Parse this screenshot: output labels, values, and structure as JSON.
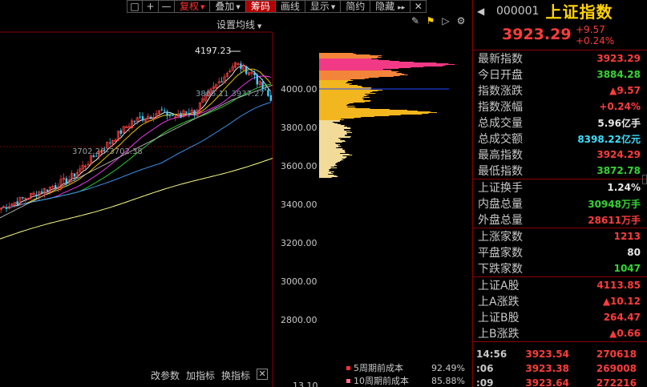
{
  "toolbar": {
    "buttons": [
      "□",
      "+",
      "—",
      "复权",
      "叠加",
      "筹码",
      "画线",
      "显示",
      "简约",
      "隐藏"
    ],
    "chevrons": "▸▸",
    "close": "✕",
    "tools": [
      "🖊",
      "⚑",
      "▷",
      "⚙"
    ]
  },
  "chart": {
    "ma_setting": "设置均线",
    "price_ticks": [
      "4000.00",
      "3800.00",
      "3600.00",
      "3400.00",
      "3200.00",
      "3000.00",
      "2800.00"
    ],
    "partial_tick": "13.10",
    "annotations": {
      "high": "4197.23",
      "ma_values": "3865.11 3937.27",
      "cost_range": "3702.26–3702.38"
    },
    "bottom": [
      "改参数",
      "加指标",
      "换指标",
      "✕"
    ],
    "cost_legend": [
      {
        "label": "5周期前成本",
        "pct": "92.49%",
        "color": "#ff3030"
      },
      {
        "label": "10周期前成本",
        "pct": "85.88%",
        "color": "#ff7090"
      }
    ]
  },
  "panel": {
    "code": "000001",
    "name": "上证指数",
    "price": "3923.29",
    "change": "+9.57",
    "change_pct": "+0.24%",
    "group1": [
      {
        "label": "最新指数",
        "value": "3923.29",
        "color": "red"
      },
      {
        "label": "今日开盘",
        "value": "3884.28",
        "color": "green"
      },
      {
        "label": "指数涨跌",
        "value": "▲9.57",
        "color": "red"
      },
      {
        "label": "指数涨幅",
        "value": "+0.24%",
        "color": "red"
      },
      {
        "label": "总成交量",
        "value": "5.96亿手",
        "color": "white"
      },
      {
        "label": "总成交额",
        "value": "8398.22亿元",
        "color": "cyan"
      },
      {
        "label": "最高指数",
        "value": "3924.29",
        "color": "red"
      },
      {
        "label": "最低指数",
        "value": "3872.78",
        "color": "green"
      }
    ],
    "group2": [
      {
        "label": "上证换手",
        "value": "1.24%",
        "color": "white"
      },
      {
        "label": "内盘总量",
        "value": "30948万手",
        "color": "green"
      },
      {
        "label": "外盘总量",
        "value": "28611万手",
        "color": "red"
      }
    ],
    "group3": [
      {
        "label": "上涨家数",
        "value": "1213",
        "color": "red"
      },
      {
        "label": "平盘家数",
        "value": "80",
        "color": "white"
      },
      {
        "label": "下跌家数",
        "value": "1047",
        "color": "green"
      }
    ],
    "group4": [
      {
        "label": "上证A股",
        "value": "4113.85",
        "color": "red"
      },
      {
        "label": "上A涨跌",
        "value": "▲10.12",
        "color": "red"
      },
      {
        "label": "上证B股",
        "value": "264.47",
        "color": "red"
      },
      {
        "label": "上B涨跌",
        "value": "▲0.66",
        "color": "red"
      }
    ],
    "ticks": [
      {
        "time": "14:56",
        "price": "3923.54",
        "vol": "270618"
      },
      {
        "time": ":06",
        "price": "3923.38",
        "vol": "269008"
      },
      {
        "time": ":09",
        "price": "3923.64",
        "vol": "272216"
      }
    ]
  }
}
